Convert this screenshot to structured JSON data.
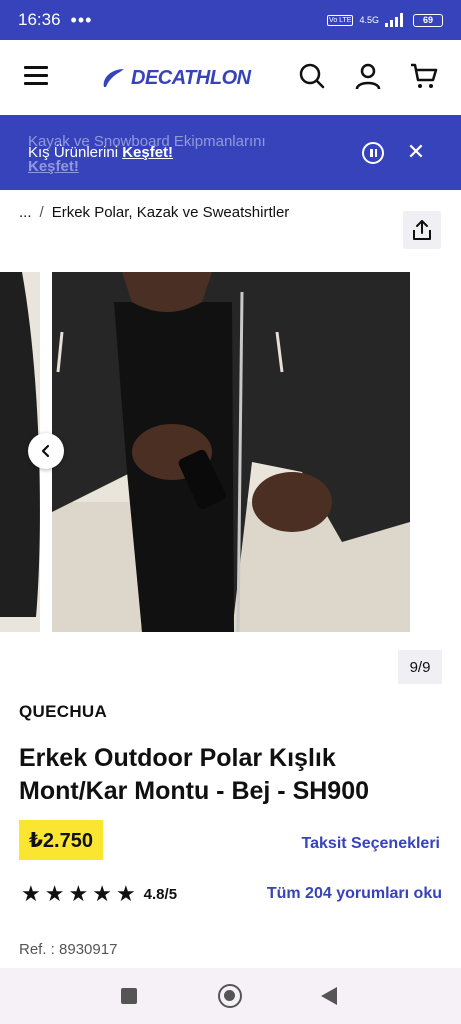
{
  "status_bar": {
    "time": "16:36",
    "dots": "•••",
    "network": "4.5G",
    "volte": "Vo LTE",
    "battery": "69"
  },
  "header": {
    "logo_text": "DECATHLON",
    "brand_color": "#3643ba",
    "icons": [
      "menu-icon",
      "search-icon",
      "account-icon",
      "cart-icon"
    ]
  },
  "promo": {
    "faded_line": "Kayak ve Snowboard Ekipmanlarını",
    "text": "Kış Ürünlerini",
    "link": "Keşfet!",
    "faded_link": "Keşfet!"
  },
  "breadcrumb": {
    "ellipsis": "...",
    "separator": "/",
    "current": "Erkek Polar, Kazak ve Sweatshirtler"
  },
  "gallery": {
    "counter": "9/9"
  },
  "product": {
    "brand": "QUECHUA",
    "title": "Erkek Outdoor Polar Kışlık Mont/Kar Montu - Bej - SH900",
    "price": "₺2.750",
    "price_bg": "#fae531",
    "installments_link": "Taksit Seçenekleri",
    "rating": 4.8,
    "rating_text": "4.8/5",
    "reviews_link": "Tüm 204 yorumları oku",
    "ref": "Ref. : 8930917"
  }
}
